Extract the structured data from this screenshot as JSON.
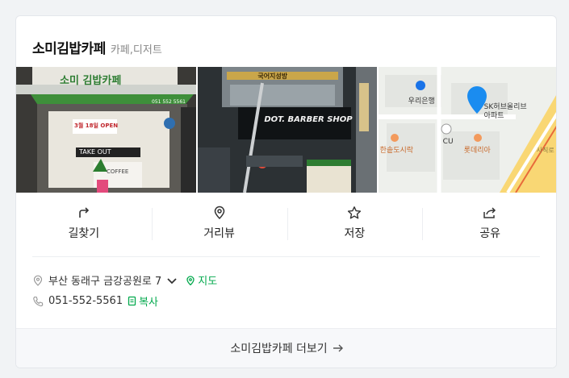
{
  "place": {
    "name": "소미김밥카페",
    "category": "카페,디저트"
  },
  "photos": {
    "shop": {
      "sign": "소미 김밥카페",
      "phone_sign": "051 552 5561",
      "menu_board": "3월 18일 OPEN",
      "takeout": "TAKE OUT",
      "coffee": "COFFEE"
    },
    "street": {
      "sign1": "국어지성방",
      "sign2": "DOT. BARBER SHOP"
    },
    "map": {
      "bank": "우리은행",
      "apt": "SK허브올리브 아파트",
      "store": "CU",
      "restaurant1": "한솥도시락",
      "restaurant2": "롯데리아",
      "road": "사직로"
    }
  },
  "actions": [
    {
      "label": "길찾기",
      "icon": "directions-icon"
    },
    {
      "label": "거리뷰",
      "icon": "street-view-icon"
    },
    {
      "label": "저장",
      "icon": "star-icon"
    },
    {
      "label": "공유",
      "icon": "share-icon"
    }
  ],
  "address": {
    "text": "부산 동래구 금강공원로 7",
    "map_link": "지도"
  },
  "phone": {
    "number": "051-552-5561",
    "copy_label": "복사"
  },
  "footer": {
    "more_label": "소미김밥카페 더보기"
  },
  "colors": {
    "accent_green": "#03a94d",
    "pin_blue": "#1a8cf0"
  }
}
